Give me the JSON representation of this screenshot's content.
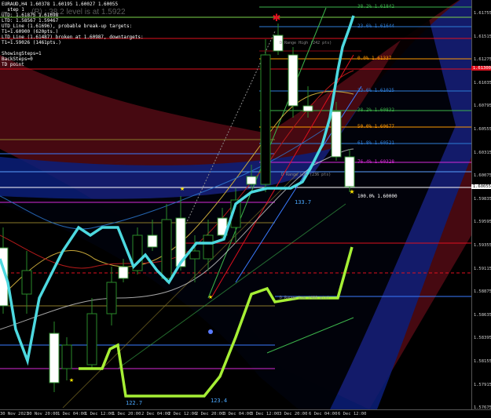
{
  "header": {
    "title": "EURAUD,H4  1.60378 1.60195 1.60027 1.60055",
    "ghost_text": "(R) : 38.2 level is at 1.5922"
  },
  "info_lines": [
    "__step 1",
    "UTD: 1.61875 1.61698",
    "LTD: 1.58567  1.59467",
    "UTD_Line (1.61696), probable break-up targets:",
    "T1=1.60900 (620pts.)",
    "LTD_Line (1.61487) broken at 1.60987, downtargets:",
    "T1=1.59026 (1461pts.)",
    "",
    "ShowingSteps=1",
    "BackSteps=0",
    "TD point"
  ],
  "price_axis": {
    "labels": [
      "1.61755",
      "1.61515",
      "1.61275",
      "1.61035",
      "1.60795",
      "1.60555",
      "1.60315",
      "1.60075",
      "1.59835",
      "1.59595",
      "1.59355",
      "1.59115",
      "1.58875",
      "1.58635",
      "1.58395",
      "1.58155",
      "1.57915",
      "1.57675"
    ],
    "tags": [
      {
        "text": "1.61300",
        "color": "#ffffff",
        "bg": "#e0101e"
      },
      {
        "text": "1.60055",
        "color": "#000000",
        "bg": "#ffffff"
      }
    ]
  },
  "time_axis": {
    "labels": [
      "30 Nov 2021",
      "30 Nov 20:00",
      "1 Dec 04:00",
      "1 Dec 12:00",
      "1 Dec 20:00",
      "2 Dec 04:00",
      "2 Dec 12:00",
      "2 Dec 20:00",
      "3 Dec 04:00",
      "3 Dec 12:00",
      "3 Dec 20:00",
      "6 Dec 04:00",
      "6 Dec 12:00"
    ]
  },
  "fib_levels": [
    {
      "text": "38.2%  1.61842",
      "color": "#3cb44b"
    },
    {
      "text": "23.6%  1.61644",
      "color": "#2e7dd7"
    },
    {
      "text": "0.0%  1.61337",
      "color": "#ff9900"
    },
    {
      "text": "23.6%  1.61025",
      "color": "#2e7dd7"
    },
    {
      "text": "38.2%  1.60832",
      "color": "#3cb44b"
    },
    {
      "text": "50.0%  1.60677",
      "color": "#ff9900"
    },
    {
      "text": "61.8%  1.60521",
      "color": "#2e7dd7"
    },
    {
      "text": "76.4%  1.60328",
      "color": "#d62ad6"
    },
    {
      "text": "100.0%  1.60000",
      "color": "#ffffff"
    }
  ],
  "annotations": {
    "range_high": "D Range High (242 pts)",
    "range_low": "D Range Low (400 pts)",
    "range_mid": "D Range Low (236 pts)",
    "num_1": "133.7",
    "num_2": "122.7",
    "num_3": "123.4"
  },
  "colors": {
    "background": "#000000",
    "cyan_line": "#4dd9e0",
    "lime_line": "#a6ef35",
    "red_channel": "#5b0b14",
    "blue_channel": "#0a1a6b",
    "candle_outline": "#2a8a2a"
  },
  "icons": {
    "peak_marker": "red-star-icon",
    "trough_marker": "yellow-star-icon"
  }
}
